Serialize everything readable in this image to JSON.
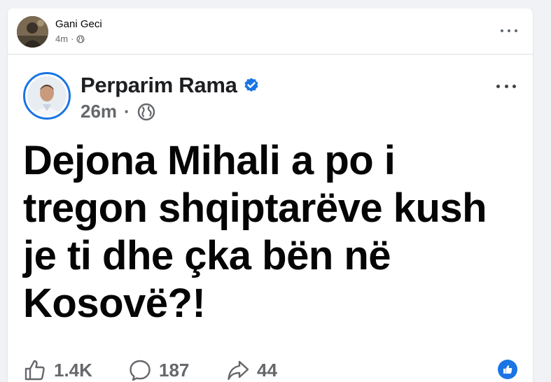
{
  "outer_post": {
    "author_name": "Gani Geci",
    "time": "4m",
    "separator": "·",
    "privacy_icon": "globe-icon"
  },
  "inner_post": {
    "author_name": "Perparim Rama",
    "verified_icon": "verified-badge-icon",
    "time": "26m",
    "separator": "·",
    "privacy_icon": "globe-icon",
    "text": "Dejona Mihali a po i tregon shqiptarëve kush je ti dhe çka bën në Kosovë?!",
    "likes": "1.4K",
    "comments": "187",
    "shares": "44"
  },
  "colors": {
    "page_bg": "#f0f2f5",
    "accent_blue": "#1b74e4",
    "text_primary": "#050505",
    "text_secondary": "#65676b"
  }
}
